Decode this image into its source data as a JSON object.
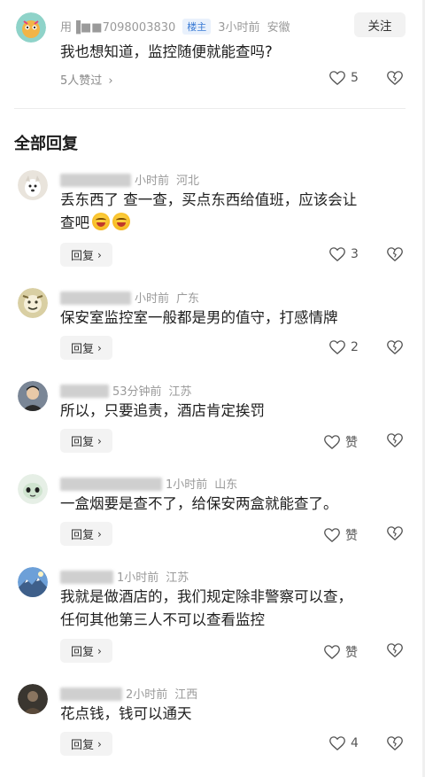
{
  "op": {
    "username": "用▐■■7098003830",
    "author_tag": "楼主",
    "time": "3小时前",
    "location": "安徽",
    "follow_label": "关注",
    "text": "我也想知道，监控随便就能查吗?",
    "liked_by": "5人赞过",
    "likes": "5"
  },
  "section_title": "全部回复",
  "reply_label": "回复",
  "comments": [
    {
      "username": "",
      "time": "小时前",
      "location": "河北",
      "line1": "丢东西了 查一查，买点东西给值班，应该会让",
      "line2": "查吧",
      "likes": "3"
    },
    {
      "username": "Map 忘家",
      "time": "小时前",
      "location": "广东",
      "line1": "保安室监控室一般都是男的值守，打感情牌",
      "line2": "",
      "likes": "2"
    },
    {
      "username": "心清",
      "time": "53分钟前",
      "location": "江苏",
      "line1": "所以，只要追责，酒店肯定挨罚",
      "line2": "",
      "likes": "赞"
    },
    {
      "username": "三",
      "time": "1小时前",
      "location": "山东",
      "line1": "一盒烟要是查不了，给保安两盒就能查了。",
      "line2": "",
      "likes": "赞"
    },
    {
      "username": "享",
      "time": "1小时前",
      "location": "江苏",
      "line1": "我就是做酒店的，我们规定除非警察可以查，",
      "line2": "任何其他第三人不可以查看监控",
      "likes": "赞"
    },
    {
      "username": "事",
      "time": "2小时前",
      "location": "江西",
      "line1": "花点钱，钱可以通天",
      "line2": "",
      "likes": "4"
    }
  ],
  "icons": {
    "like": "heart-icon",
    "dislike": "broken-heart-icon",
    "chevron": "chevron-right-icon"
  }
}
